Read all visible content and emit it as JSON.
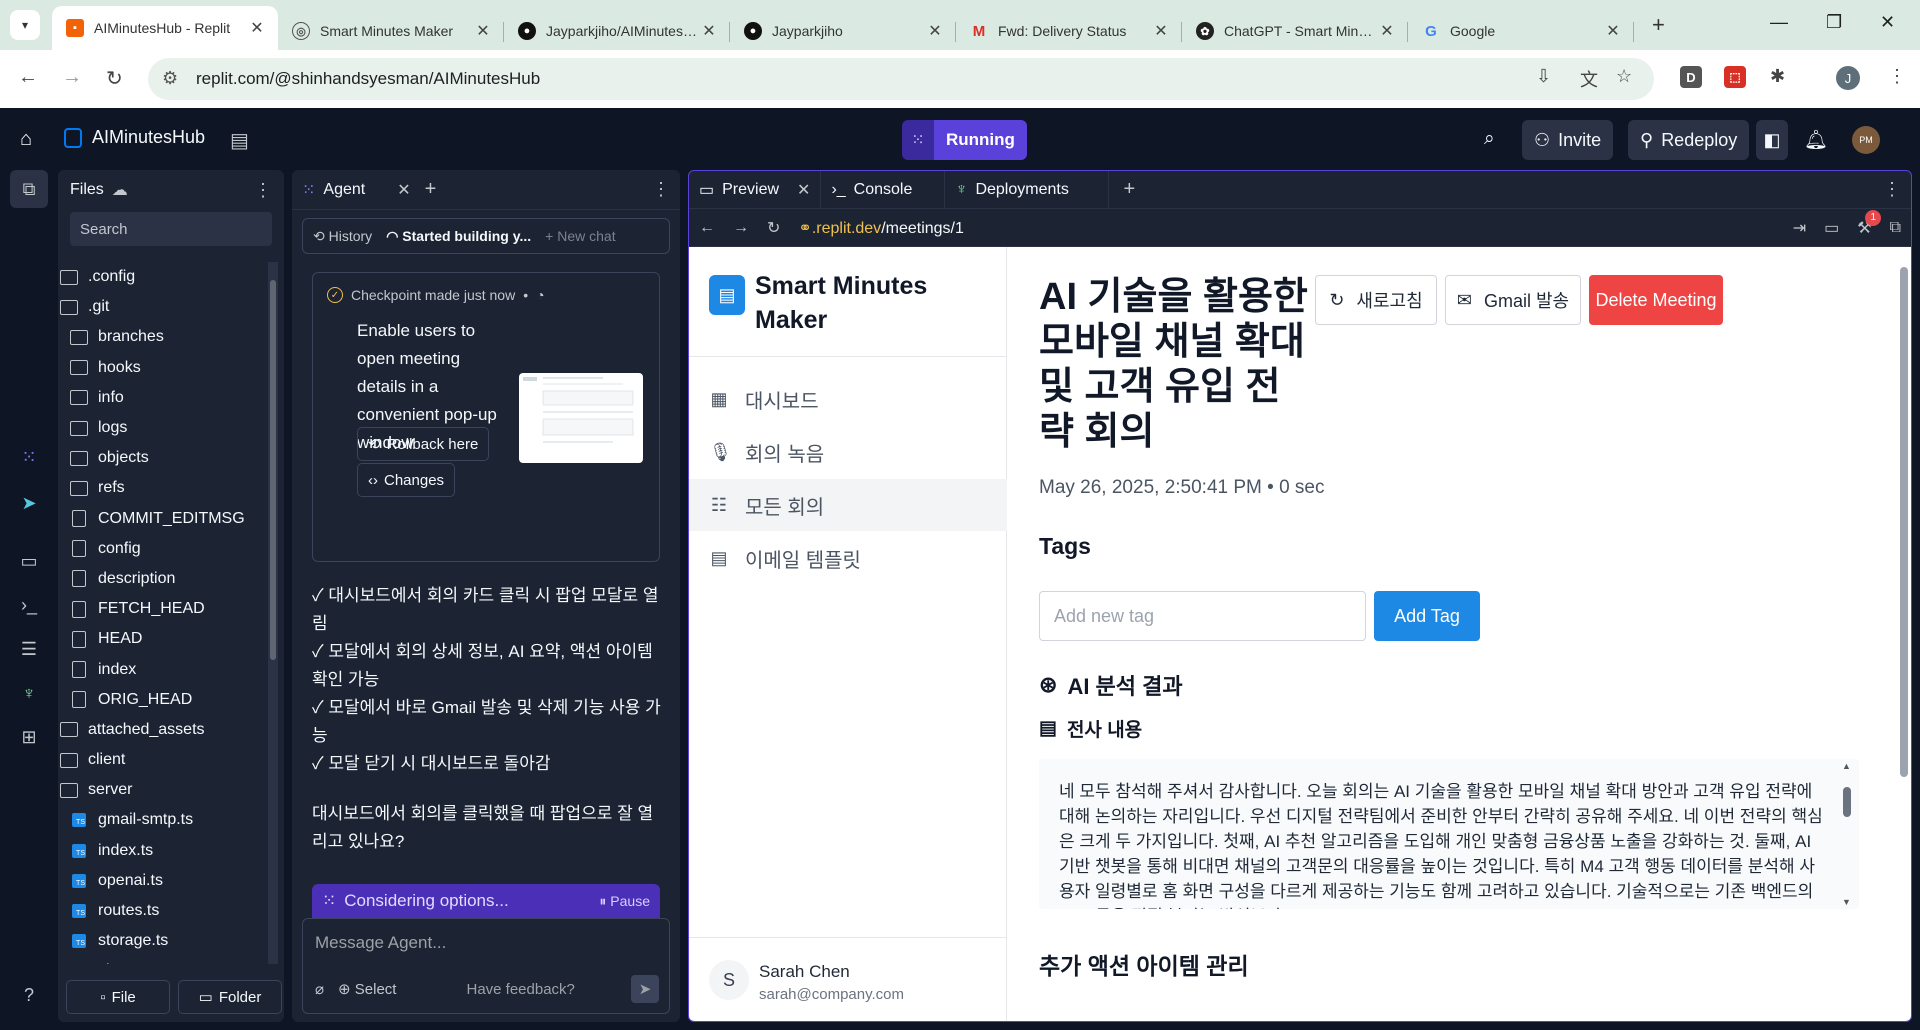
{
  "browser": {
    "tabs": [
      {
        "title": "AIMinutesHub - Replit",
        "active": true
      },
      {
        "title": "Smart Minutes Maker"
      },
      {
        "title": "Jayparkjiho/AIMinutesHub"
      },
      {
        "title": "Jayparkjiho"
      },
      {
        "title": "Fwd: Delivery Status"
      },
      {
        "title": "ChatGPT - Smart Minutes"
      },
      {
        "title": "Google"
      }
    ],
    "url": "replit.com/@shinhandsyesman/AIMinutesHub",
    "ext_d": "D",
    "profile_initial": "J"
  },
  "topbar": {
    "repl_name": "AIMinutesHub",
    "run_label": "Running",
    "invite_label": "Invite",
    "redeploy_label": "Redeploy",
    "avatar_initials": "PM"
  },
  "files": {
    "title": "Files",
    "search_placeholder": "Search",
    "tree": [
      {
        "name": ".config",
        "type": "folder",
        "depth": 0
      },
      {
        "name": ".git",
        "type": "folder",
        "depth": 0
      },
      {
        "name": "branches",
        "type": "folder",
        "depth": 1
      },
      {
        "name": "hooks",
        "type": "folder",
        "depth": 1
      },
      {
        "name": "info",
        "type": "folder",
        "depth": 1
      },
      {
        "name": "logs",
        "type": "folder",
        "depth": 1
      },
      {
        "name": "objects",
        "type": "folder",
        "depth": 1
      },
      {
        "name": "refs",
        "type": "folder",
        "depth": 1
      },
      {
        "name": "COMMIT_EDITMSG",
        "type": "file",
        "depth": 1
      },
      {
        "name": "config",
        "type": "file",
        "depth": 1
      },
      {
        "name": "description",
        "type": "file",
        "depth": 1
      },
      {
        "name": "FETCH_HEAD",
        "type": "file",
        "depth": 1
      },
      {
        "name": "HEAD",
        "type": "file",
        "depth": 1
      },
      {
        "name": "index",
        "type": "file",
        "depth": 1
      },
      {
        "name": "ORIG_HEAD",
        "type": "file",
        "depth": 1
      },
      {
        "name": "attached_assets",
        "type": "folder",
        "depth": 0
      },
      {
        "name": "client",
        "type": "folder",
        "depth": 0
      },
      {
        "name": "server",
        "type": "folder",
        "depth": 0
      },
      {
        "name": "gmail-smtp.ts",
        "type": "ts",
        "depth": 1
      },
      {
        "name": "index.ts",
        "type": "ts",
        "depth": 1
      },
      {
        "name": "openai.ts",
        "type": "ts",
        "depth": 1
      },
      {
        "name": "routes.ts",
        "type": "ts",
        "depth": 1
      },
      {
        "name": "storage.ts",
        "type": "ts",
        "depth": 1
      },
      {
        "name": "vite.ts",
        "type": "ts",
        "depth": 1
      }
    ],
    "file_btn": "File",
    "folder_btn": "Folder"
  },
  "agent": {
    "tab_label": "Agent",
    "history_label": "History",
    "current_chat": "Started building y...",
    "new_chat_label": "New chat",
    "checkpoint_label": "Checkpoint made just now",
    "checkpoint_text": "Enable users to open meeting details in a convenient pop-up window",
    "rollback_label": "Rollback here",
    "changes_label": "Changes",
    "messages": [
      "✓ 대시보드에서 회의 카드 클릭 시 팝업 모달로 열림",
      "✓ 모달에서 회의 상세 정보, AI 요약, 액션 아이템 확인 가능",
      "✓ 모달에서 바로 Gmail 발송 및 삭제 기능 사용 가능",
      "✓ 모달 닫기 시 대시보드로 돌아감"
    ],
    "question": "대시보드에서 회의를 클릭했을 때 팝업으로 잘 열리고 있나요?",
    "status_label": "Considering options...",
    "pause_label": "Pause",
    "input_placeholder": "Message Agent...",
    "select_label": "Select",
    "feedback_label": "Have feedback?"
  },
  "preview": {
    "tabs": [
      "Preview",
      "Console",
      "Deployments"
    ],
    "url_domain": ".replit.dev",
    "url_path": "/meetings/1",
    "notification_count": "1"
  },
  "app": {
    "brand": "Smart Minutes Maker",
    "nav": [
      {
        "label": "대시보드",
        "icon": "dashboard-icon"
      },
      {
        "label": "회의 녹음",
        "icon": "mic-icon"
      },
      {
        "label": "모든 회의",
        "icon": "list-icon",
        "active": true
      },
      {
        "label": "이메일 템플릿",
        "icon": "template-icon"
      }
    ],
    "user": {
      "initial": "S",
      "name": "Sarah Chen",
      "email": "sarah@company.com"
    },
    "meeting_title": "AI 기술을 활용한 모바일 채널 확대 및 고객 유입 전략 회의",
    "refresh_label": "새로고침",
    "gmail_label": "Gmail 발송",
    "delete_label": "Delete Meeting",
    "meta": "May 26, 2025, 2:50:41 PM • 0 sec",
    "tags_heading": "Tags",
    "tag_placeholder": "Add new tag",
    "add_tag_label": "Add Tag",
    "ai_heading": "AI 분석 결과",
    "transcript_heading": "전사 내용",
    "transcript": "네 모두 참석해 주셔서 감사합니다. 오늘 회의는 AI 기술을 활용한 모바일 채널 확대 방안과 고객 유입 전략에 대해 논의하는 자리입니다. 우선 디지털 전략팀에서 준비한 안부터 간략히 공유해 주세요. 네 이번 전략의 핵심은 크게 두 가지입니다. 첫째, AI 추천 알고리즘을 도입해 개인 맞춤형 금융상품 노출을 강화하는 것. 둘째, AI 기반 챗봇을 통해 비대면 채널의 고객문의 대응률을 높이는 것입니다. 특히 M4 고객 행동 데이터를 분석해 사용자 일령별로 홈 화면 구성을 다르게 제공하는 기능도 함께 고려하고 있습니다. 기술적으로는 기존 백엔드의 AI 모듈을 직접 붙이는 방식보다",
    "action_heading": "추가 액션 아이템 관리"
  },
  "colors": {
    "replit_bg": "#0e1525",
    "pane_bg": "#1c2333",
    "run_purple": "#5941d9",
    "app_blue": "#1e88e5",
    "delete_red": "#ef4444"
  }
}
